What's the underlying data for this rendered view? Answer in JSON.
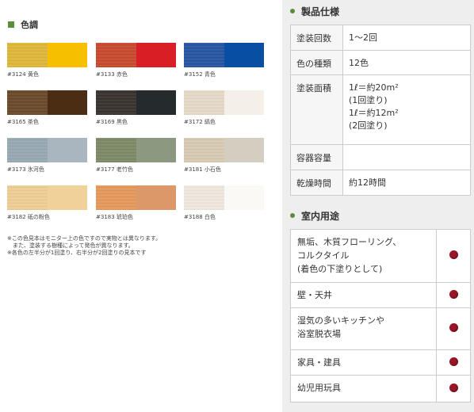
{
  "colors": {
    "section_title": "色調",
    "swatches": [
      {
        "code": "#3124",
        "name": "黄色",
        "left": "#e0b83a",
        "right": "#f6c000"
      },
      {
        "code": "#3133",
        "name": "赤色",
        "left": "#c84a2e",
        "right": "#d91e26"
      },
      {
        "code": "#3152",
        "name": "青色",
        "left": "#2856a3",
        "right": "#084fa4"
      },
      {
        "code": "#3165",
        "name": "茶色",
        "left": "#6b4a2a",
        "right": "#4a2d12"
      },
      {
        "code": "#3169",
        "name": "黒色",
        "left": "#3a3430",
        "right": "#252a2d"
      },
      {
        "code": "#3172",
        "name": "縞色",
        "left": "#e6dac8",
        "right": "#f4f0e8"
      },
      {
        "code": "#3173",
        "name": "氷河色",
        "left": "#98aab4",
        "right": "#a9b6bf"
      },
      {
        "code": "#3177",
        "name": "老竹色",
        "left": "#7e8a68",
        "right": "#8c9880"
      },
      {
        "code": "#3181",
        "name": "小石色",
        "left": "#d9cbb4",
        "right": "#d4cec0"
      },
      {
        "code": "#3182",
        "name": "砥の粉色",
        "left": "#f0cf96",
        "right": "#f1d19a"
      },
      {
        "code": "#3183",
        "name": "琥珀色",
        "left": "#e69a5c",
        "right": "#dd9869"
      },
      {
        "code": "#3188",
        "name": "白色",
        "left": "#efe8de",
        "right": "#faf9f6"
      }
    ],
    "notes": [
      "※この色見本はモニター上の色ですので実物とは異なります。",
      "　また、塗装する樹種によって発色が異なります。",
      "※各色の左半分が1回塗り、右半分が2回塗りの見本です"
    ]
  },
  "spec": {
    "title": "製品仕様",
    "rows": [
      {
        "label": "塗装回数",
        "lines": [
          "1〜2回"
        ]
      },
      {
        "label": "色の種類",
        "lines": [
          "12色"
        ]
      },
      {
        "label": "塗装面積",
        "lines": [
          "1ℓ＝約20m²",
          "(1回塗り)",
          "1ℓ＝約12m²",
          "(2回塗り)"
        ]
      },
      {
        "label": "容器容量",
        "lines": [
          ""
        ]
      },
      {
        "label": "乾燥時間",
        "lines": [
          "約12時間"
        ]
      }
    ]
  },
  "uses": {
    "title": "室内用途",
    "rows": [
      {
        "lines": [
          "無垢、木質フローリング、",
          "コルクタイル",
          "(着色の下塗りとして)"
        ]
      },
      {
        "lines": [
          "壁・天井"
        ]
      },
      {
        "lines": [
          "湿気の多いキッチンや",
          "浴室脱衣場"
        ]
      },
      {
        "lines": [
          "家具・建具"
        ]
      },
      {
        "lines": [
          "幼児用玩具"
        ]
      }
    ],
    "marker_color": "#9a1626"
  }
}
